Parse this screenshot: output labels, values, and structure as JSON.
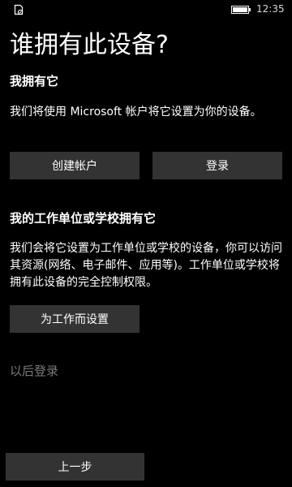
{
  "status_bar": {
    "time": "12:35",
    "left_icon": "phone-status-icon",
    "battery_icon": "battery-icon"
  },
  "title": "谁拥有此设备?",
  "personal": {
    "heading": "我拥有它",
    "description": "我们将使用 Microsoft 帐户将它设置为你的设备。",
    "create_account_label": "创建帐户",
    "sign_in_label": "登录"
  },
  "work": {
    "heading": "我的工作单位或学校拥有它",
    "description": "我们会将它设置为工作单位或学校的设备，你可以访问其资源(网络、电子邮件、应用等)。工作单位或学校将拥有此设备的完全控制权限。",
    "setup_label": "为工作而设置"
  },
  "sign_in_later_label": "以后登录",
  "back_label": "上一步",
  "colors": {
    "background": "#000000",
    "button": "#333333",
    "muted_text": "#7a7a7a"
  }
}
